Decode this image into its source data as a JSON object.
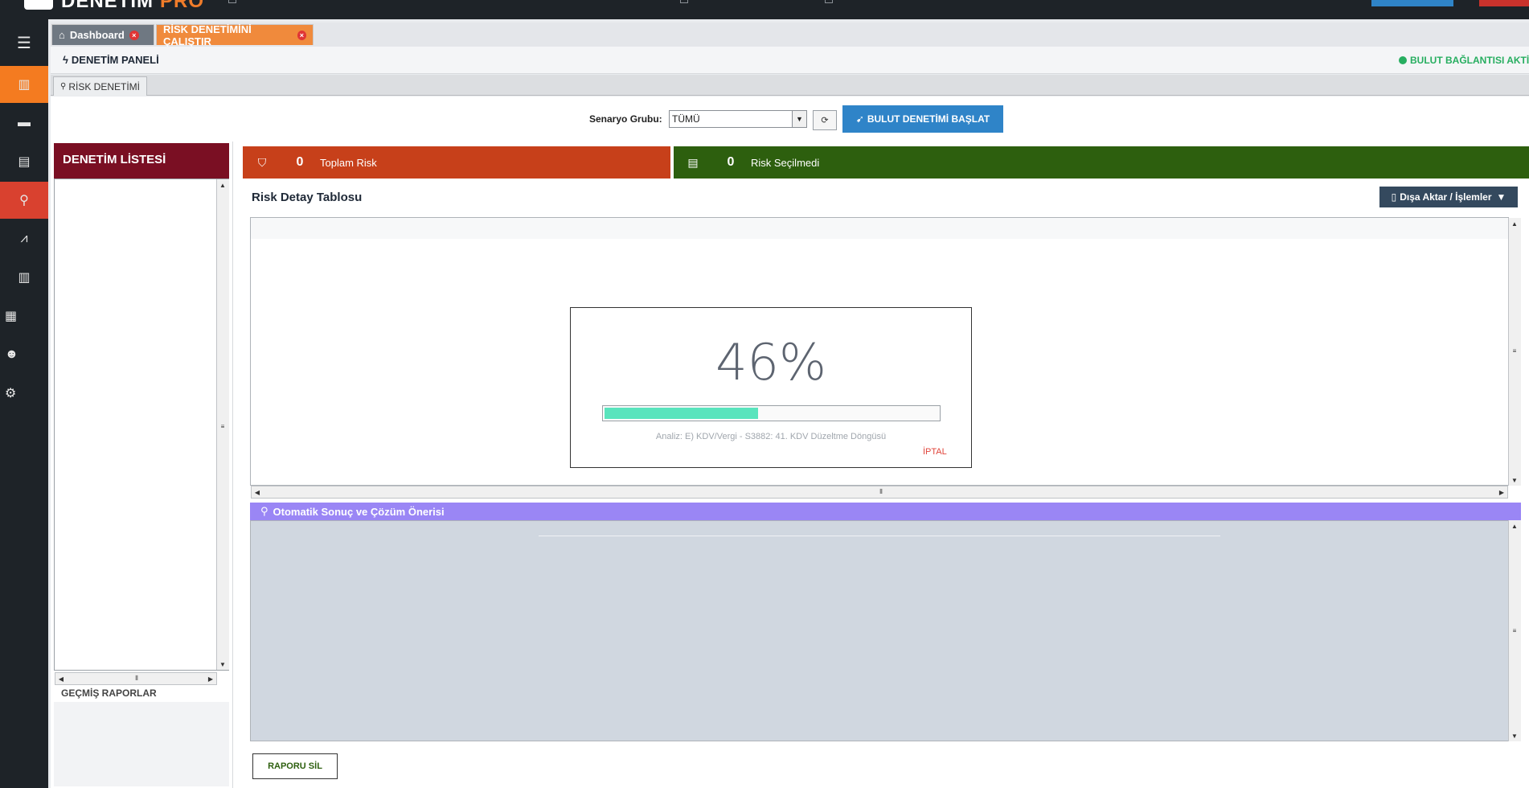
{
  "topbar": {
    "brand_name": "DENETİM",
    "brand_suffix": "PRO"
  },
  "tabs": [
    {
      "label": "Dashboard",
      "close": "×"
    },
    {
      "label": "RİSK DENETİMİNİ ÇALIŞTIR",
      "close": "×"
    }
  ],
  "panel": {
    "title": "DENETİM PANELİ",
    "cloud_status": "BULUT BAĞLANTISI AKTİF",
    "subtab": "RİSK DENETİMİ"
  },
  "toolbar": {
    "scenario_label": "Senaryo Grubu:",
    "scenario_value": "TÜMÜ",
    "start_label": "BULUT DENETİMİ BAŞLAT"
  },
  "left": {
    "header": "DENETİM LİSTESİ",
    "history_label": "GEÇMİŞ RAPORLAR"
  },
  "stats": [
    {
      "value": "0",
      "label": "Toplam Risk",
      "color": "#c7401a"
    },
    {
      "value": "0",
      "label": "Risk Seçilmedi",
      "color": "#2d5f0e"
    }
  ],
  "detail": {
    "title": "Risk Detay Tablosu",
    "export_label": "Dışa Aktar / İşlemler"
  },
  "progress": {
    "percent_text": "46%",
    "fraction": 0.46,
    "message": "Analiz: E) KDV/Vergi  - S3882: 41. KDV Düzeltme Döngüsü",
    "cancel_label": "İPTAL"
  },
  "solution": {
    "title": "Otomatik Sonuç ve Çözüm Önerisi"
  },
  "footer": {
    "delete_label": "RAPORU SİL"
  },
  "colors": {
    "accent_orange": "#f47b20",
    "accent_blue": "#2f84c8",
    "dark_red": "#7a0f23",
    "progress_fill": "#59e4bd",
    "solution_purple": "#9a86f5",
    "status_green": "#27ae60"
  }
}
